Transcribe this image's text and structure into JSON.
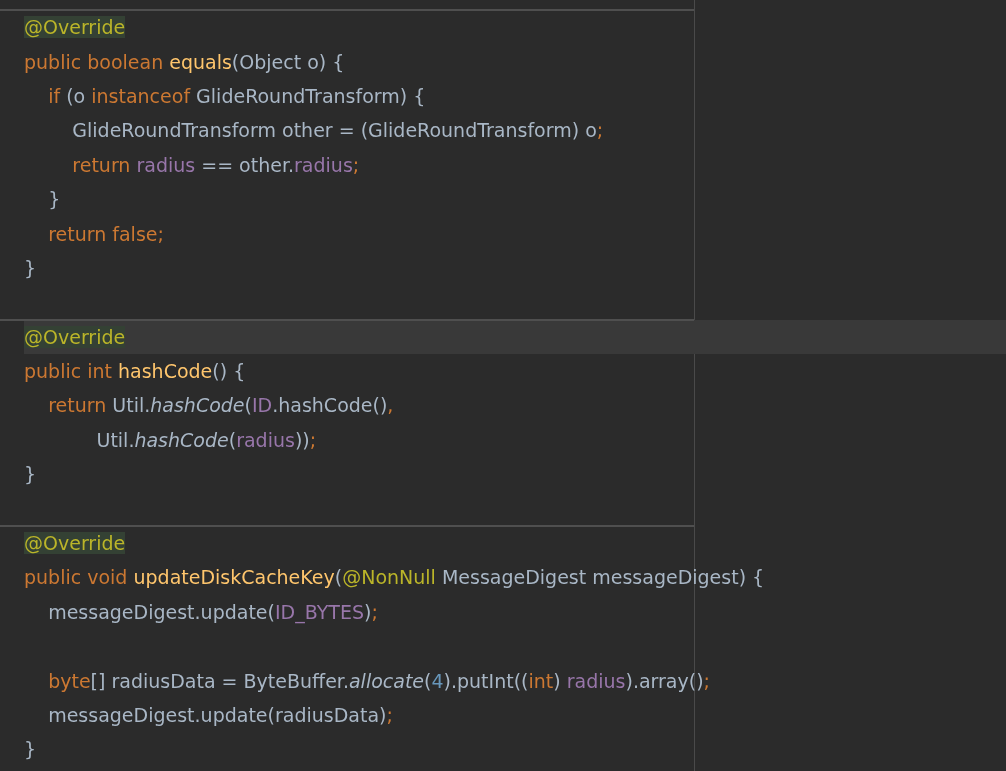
{
  "editor": {
    "lines": [
      {
        "separator_above": true,
        "gap_above": false,
        "current": false,
        "tokens": [
          {
            "text": "@Override",
            "kind": "annotation-hl"
          }
        ]
      },
      {
        "separator_above": false,
        "gap_above": false,
        "current": false,
        "tokens": [
          {
            "text": "public boolean ",
            "kind": "keyword"
          },
          {
            "text": "equals",
            "kind": "method"
          },
          {
            "text": "(Object o) {",
            "kind": "plain"
          }
        ]
      },
      {
        "separator_above": false,
        "gap_above": false,
        "current": false,
        "tokens": [
          {
            "text": "    if",
            "kind": "keyword"
          },
          {
            "text": " (o ",
            "kind": "plain"
          },
          {
            "text": "instanceof",
            "kind": "keyword"
          },
          {
            "text": " GlideRoundTransform) {",
            "kind": "plain"
          }
        ]
      },
      {
        "separator_above": false,
        "gap_above": false,
        "current": false,
        "tokens": [
          {
            "text": "        GlideRoundTransform other = (GlideRoundTransform) o",
            "kind": "plain"
          },
          {
            "text": ";",
            "kind": "keyword"
          }
        ]
      },
      {
        "separator_above": false,
        "gap_above": false,
        "current": false,
        "tokens": [
          {
            "text": "        return ",
            "kind": "keyword"
          },
          {
            "text": "radius",
            "kind": "field"
          },
          {
            "text": " == other.",
            "kind": "plain"
          },
          {
            "text": "radius",
            "kind": "field"
          },
          {
            "text": ";",
            "kind": "keyword"
          }
        ]
      },
      {
        "separator_above": false,
        "gap_above": false,
        "current": false,
        "tokens": [
          {
            "text": "    }",
            "kind": "plain"
          }
        ]
      },
      {
        "separator_above": false,
        "gap_above": false,
        "current": false,
        "tokens": [
          {
            "text": "    return false;",
            "kind": "keyword"
          }
        ]
      },
      {
        "separator_above": false,
        "gap_above": false,
        "current": false,
        "tokens": [
          {
            "text": "}",
            "kind": "plain"
          }
        ]
      },
      {
        "separator_above": true,
        "gap_above": true,
        "current": true,
        "tokens": [
          {
            "text": "@Override",
            "kind": "annotation-hl"
          }
        ]
      },
      {
        "separator_above": false,
        "gap_above": false,
        "current": false,
        "tokens": [
          {
            "text": "public int ",
            "kind": "keyword"
          },
          {
            "text": "hashCode",
            "kind": "method"
          },
          {
            "text": "() {",
            "kind": "plain"
          }
        ]
      },
      {
        "separator_above": false,
        "gap_above": false,
        "current": false,
        "tokens": [
          {
            "text": "    return",
            "kind": "keyword"
          },
          {
            "text": " Util.",
            "kind": "plain"
          },
          {
            "text": "hashCode",
            "kind": "static"
          },
          {
            "text": "(",
            "kind": "plain"
          },
          {
            "text": "ID",
            "kind": "field"
          },
          {
            "text": ".hashCode()",
            "kind": "plain"
          },
          {
            "text": ",",
            "kind": "keyword"
          }
        ]
      },
      {
        "separator_above": false,
        "gap_above": false,
        "current": false,
        "tokens": [
          {
            "text": "            Util.",
            "kind": "plain"
          },
          {
            "text": "hashCode",
            "kind": "static"
          },
          {
            "text": "(",
            "kind": "plain"
          },
          {
            "text": "radius",
            "kind": "field"
          },
          {
            "text": "))",
            "kind": "plain"
          },
          {
            "text": ";",
            "kind": "keyword"
          }
        ]
      },
      {
        "separator_above": false,
        "gap_above": false,
        "current": false,
        "tokens": [
          {
            "text": "}",
            "kind": "plain"
          }
        ]
      },
      {
        "separator_above": true,
        "gap_above": true,
        "current": false,
        "tokens": [
          {
            "text": "@Override",
            "kind": "annotation-hl"
          }
        ]
      },
      {
        "separator_above": false,
        "gap_above": false,
        "current": false,
        "tokens": [
          {
            "text": "public void ",
            "kind": "keyword"
          },
          {
            "text": "updateDiskCacheKey",
            "kind": "method"
          },
          {
            "text": "(",
            "kind": "plain"
          },
          {
            "text": "@NonNull",
            "kind": "annotation"
          },
          {
            "text": " MessageDigest messageDigest) {",
            "kind": "plain"
          }
        ]
      },
      {
        "separator_above": false,
        "gap_above": false,
        "current": false,
        "tokens": [
          {
            "text": "    messageDigest.update(",
            "kind": "plain"
          },
          {
            "text": "ID_BYTES",
            "kind": "field"
          },
          {
            "text": ")",
            "kind": "plain"
          },
          {
            "text": ";",
            "kind": "keyword"
          }
        ]
      },
      {
        "separator_above": false,
        "gap_above": true,
        "current": false,
        "tokens": [
          {
            "text": "    byte",
            "kind": "keyword"
          },
          {
            "text": "[] radiusData = ByteBuffer.",
            "kind": "plain"
          },
          {
            "text": "allocate",
            "kind": "static"
          },
          {
            "text": "(",
            "kind": "plain"
          },
          {
            "text": "4",
            "kind": "number"
          },
          {
            "text": ").putInt((",
            "kind": "plain"
          },
          {
            "text": "int",
            "kind": "keyword"
          },
          {
            "text": ") ",
            "kind": "plain"
          },
          {
            "text": "radius",
            "kind": "field"
          },
          {
            "text": ").array()",
            "kind": "plain"
          },
          {
            "text": ";",
            "kind": "keyword"
          }
        ]
      },
      {
        "separator_above": false,
        "gap_above": false,
        "current": false,
        "tokens": [
          {
            "text": "    messageDigest.update(radiusData)",
            "kind": "plain"
          },
          {
            "text": ";",
            "kind": "keyword"
          }
        ]
      },
      {
        "separator_above": false,
        "gap_above": false,
        "current": false,
        "tokens": [
          {
            "text": "}",
            "kind": "plain"
          }
        ]
      }
    ]
  }
}
